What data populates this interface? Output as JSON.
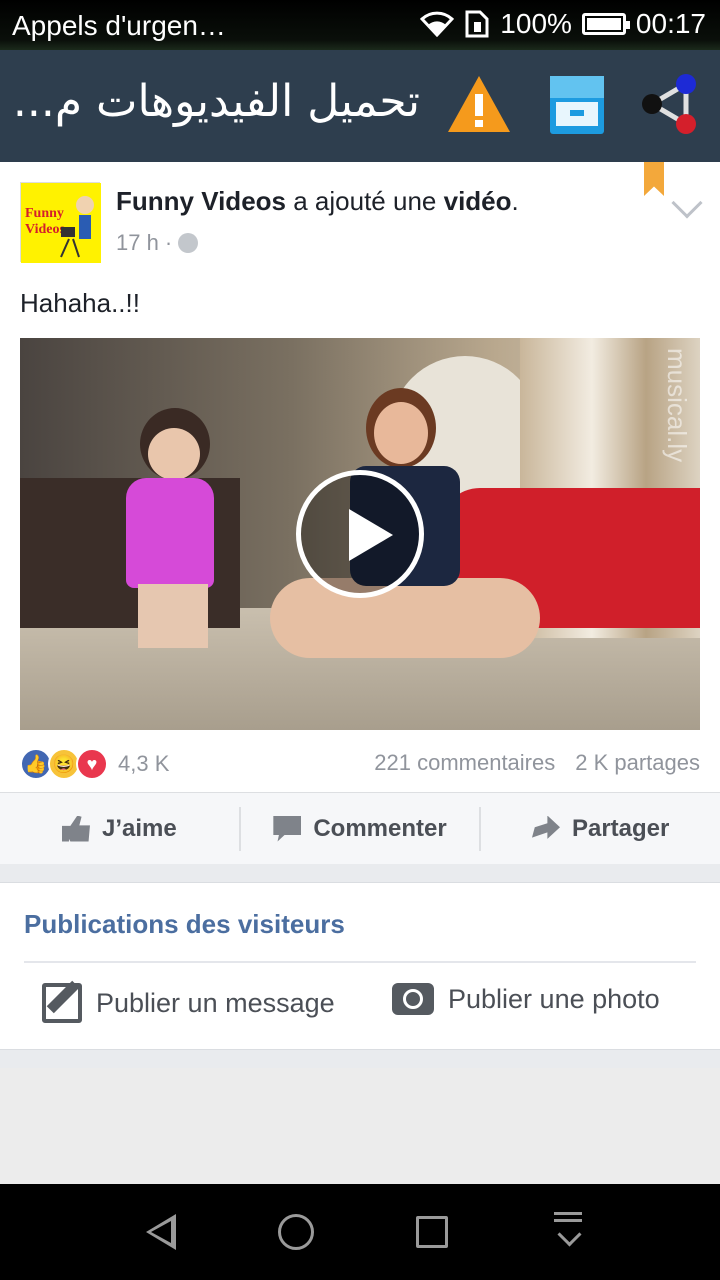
{
  "status_bar": {
    "carrier": "Appels d'urgen…",
    "battery": "100%",
    "battery_level": 1.0,
    "time": "00:17"
  },
  "app_bar": {
    "title": "تحميل الفيديوهات م..."
  },
  "post": {
    "page_name": "Funny Videos",
    "action_text": "a ajouté une",
    "object": "vidéo",
    "period": ".",
    "time": "17 h",
    "dot": "·",
    "text": "Hahaha..!!",
    "watermark": "musical.ly",
    "reactions_count": "4,3 K",
    "comments": "221 commentaires",
    "shares": "2 K partages",
    "actions": {
      "like": "J’aime",
      "comment": "Commenter",
      "share": "Partager"
    }
  },
  "visitors": {
    "heading": "Publications des visiteurs",
    "post_message": "Publier un message",
    "post_photo": "Publier une photo"
  },
  "colors": {
    "app_bar": "#2e3e4e",
    "link_blue": "#4b6ea0",
    "like_blue": "#4267b2",
    "love_red": "#e9374e",
    "haha_yellow": "#f7c339"
  }
}
